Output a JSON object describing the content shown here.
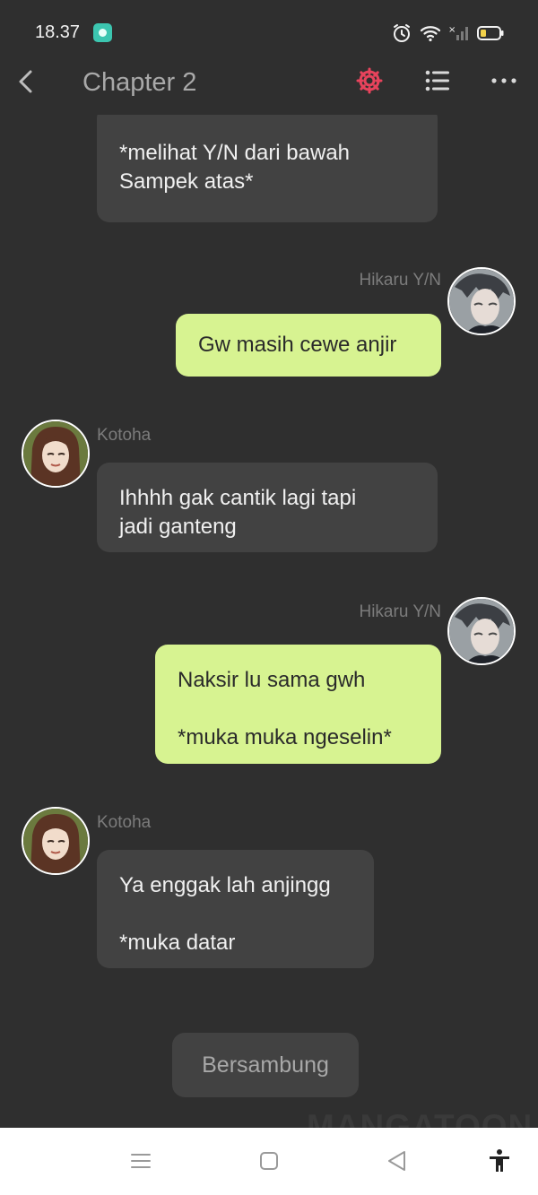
{
  "status_bar": {
    "time": "18.37"
  },
  "app_bar": {
    "title": "Chapter 2"
  },
  "chat": {
    "messages": [
      {
        "side": "left",
        "text": "*melihat Y/N dari bawah\nSampek atas*"
      },
      {
        "side": "right",
        "sender": "Hikaru Y/N",
        "text": "Gw masih cewe anjir"
      },
      {
        "side": "left",
        "sender": "Kotoha",
        "text": "Ihhhh gak cantik lagi tapi\njadi ganteng"
      },
      {
        "side": "right",
        "sender": "Hikaru Y/N",
        "text": "Naksir lu sama gwh\n\n*muka muka ngeselin*"
      },
      {
        "side": "left",
        "sender": "Kotoha",
        "text": "Ya enggak lah anjingg\n\n*muka datar"
      }
    ],
    "continue_label": "Bersambung",
    "watermark": "MANGATOON"
  },
  "colors": {
    "background": "#2f2f2f",
    "bubble_left": "#424242",
    "bubble_right": "#d7f391",
    "accent_settings": "#e8435c"
  },
  "icons": {
    "back": "chevron-left-icon",
    "settings": "gear-icon",
    "list": "list-icon",
    "more": "more-horizontal-icon",
    "nav_menu": "menu-icon",
    "nav_home": "square-icon",
    "nav_back": "triangle-back-icon",
    "accessibility": "accessibility-icon"
  }
}
